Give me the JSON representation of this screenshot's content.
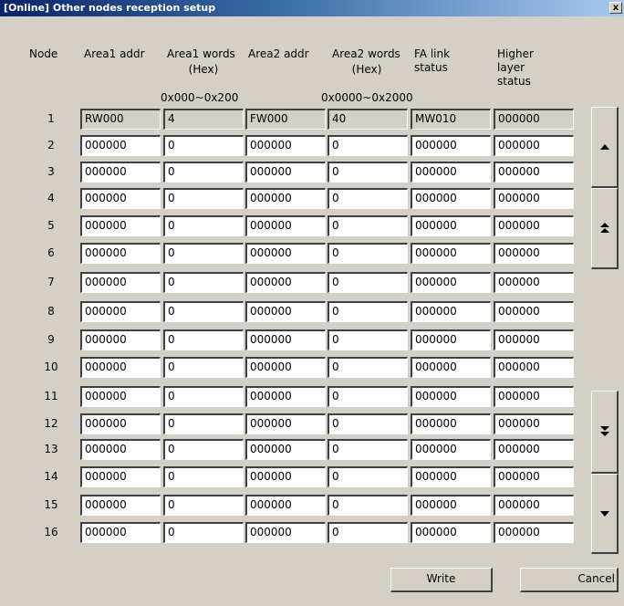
{
  "window": {
    "title": "[Online] Other nodes reception setup",
    "close_label": "x"
  },
  "headers": {
    "node": "Node",
    "area1_addr": "Area1 addr",
    "area1_words": "Area1 words",
    "area1_words_unit": "(Hex)",
    "area1_range": "0x000~0x200",
    "area2_addr": "Area2 addr",
    "area2_words": "Area2 words",
    "area2_words_unit": "(Hex)",
    "area2_range": "0x0000~0x2000",
    "fa_link_status_l1": "FA link",
    "fa_link_status_l2": "status",
    "higher_layer_status_l1": "Higher",
    "higher_layer_status_l2": "layer",
    "higher_layer_status_l3": "status"
  },
  "rows": [
    {
      "node": "1",
      "area1_addr": "RW000",
      "area1_words": "4",
      "area2_addr": "FW000",
      "area2_words": "40",
      "fa_link": "MW010",
      "higher": "000000"
    },
    {
      "node": "2",
      "area1_addr": "000000",
      "area1_words": "0",
      "area2_addr": "000000",
      "area2_words": "0",
      "fa_link": "000000",
      "higher": "000000"
    },
    {
      "node": "3",
      "area1_addr": "000000",
      "area1_words": "0",
      "area2_addr": "000000",
      "area2_words": "0",
      "fa_link": "000000",
      "higher": "000000"
    },
    {
      "node": "4",
      "area1_addr": "000000",
      "area1_words": "0",
      "area2_addr": "000000",
      "area2_words": "0",
      "fa_link": "000000",
      "higher": "000000"
    },
    {
      "node": "5",
      "area1_addr": "000000",
      "area1_words": "0",
      "area2_addr": "000000",
      "area2_words": "0",
      "fa_link": "000000",
      "higher": "000000"
    },
    {
      "node": "6",
      "area1_addr": "000000",
      "area1_words": "0",
      "area2_addr": "000000",
      "area2_words": "0",
      "fa_link": "000000",
      "higher": "000000"
    },
    {
      "node": "7",
      "area1_addr": "000000",
      "area1_words": "0",
      "area2_addr": "000000",
      "area2_words": "0",
      "fa_link": "000000",
      "higher": "000000"
    },
    {
      "node": "8",
      "area1_addr": "000000",
      "area1_words": "0",
      "area2_addr": "000000",
      "area2_words": "0",
      "fa_link": "000000",
      "higher": "000000"
    },
    {
      "node": "9",
      "area1_addr": "000000",
      "area1_words": "0",
      "area2_addr": "000000",
      "area2_words": "0",
      "fa_link": "000000",
      "higher": "000000"
    },
    {
      "node": "10",
      "area1_addr": "000000",
      "area1_words": "0",
      "area2_addr": "000000",
      "area2_words": "0",
      "fa_link": "000000",
      "higher": "000000"
    },
    {
      "node": "11",
      "area1_addr": "000000",
      "area1_words": "0",
      "area2_addr": "000000",
      "area2_words": "0",
      "fa_link": "000000",
      "higher": "000000"
    },
    {
      "node": "12",
      "area1_addr": "000000",
      "area1_words": "0",
      "area2_addr": "000000",
      "area2_words": "0",
      "fa_link": "000000",
      "higher": "000000"
    },
    {
      "node": "13",
      "area1_addr": "000000",
      "area1_words": "0",
      "area2_addr": "000000",
      "area2_words": "0",
      "fa_link": "000000",
      "higher": "000000"
    },
    {
      "node": "14",
      "area1_addr": "000000",
      "area1_words": "0",
      "area2_addr": "000000",
      "area2_words": "0",
      "fa_link": "000000",
      "higher": "000000"
    },
    {
      "node": "15",
      "area1_addr": "000000",
      "area1_words": "0",
      "area2_addr": "000000",
      "area2_words": "0",
      "fa_link": "000000",
      "higher": "000000"
    },
    {
      "node": "16",
      "area1_addr": "000000",
      "area1_words": "0",
      "area2_addr": "000000",
      "area2_words": "0",
      "fa_link": "000000",
      "higher": "000000"
    }
  ],
  "nav_buttons": [
    {
      "name": "scroll-up",
      "icon": "arrow-up-icon"
    },
    {
      "name": "page-up",
      "icon": "double-arrow-up-icon"
    },
    {
      "name": "page-down",
      "icon": "double-arrow-down-icon"
    },
    {
      "name": "scroll-down",
      "icon": "arrow-down-icon"
    }
  ],
  "buttons": {
    "write": "Write",
    "cancel": "Cancel"
  },
  "colors": {
    "title_bar_start": "#0a246a",
    "title_bar_end": "#a6caf0",
    "dialog_bg": "#d4d0c8",
    "readonly_cell_bg": "#d4d0c8"
  }
}
